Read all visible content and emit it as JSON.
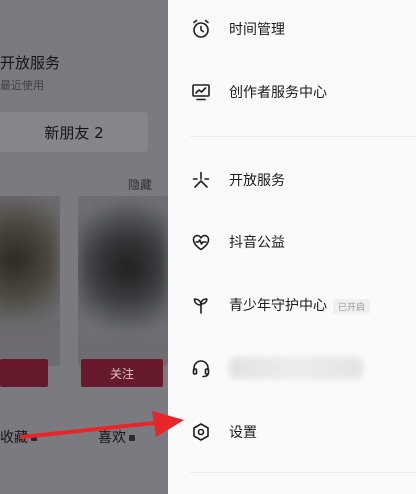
{
  "background": {
    "section_title": "开放服务",
    "section_sub": "最近使用",
    "new_friends": "新朋友 2",
    "hide": "隐藏",
    "follow_button_1": "",
    "follow_button_2": "关注",
    "tab_favorites": "收藏",
    "tab_likes": "喜欢"
  },
  "drawer": {
    "items": [
      {
        "label": "时间管理",
        "icon": "alarm-clock-icon"
      },
      {
        "label": "创作者服务中心",
        "icon": "chart-monitor-icon"
      },
      {
        "label": "开放服务",
        "icon": "asterisk-icon"
      },
      {
        "label": "抖音公益",
        "icon": "heart-pulse-icon"
      },
      {
        "label": "青少年守护中心",
        "icon": "sprout-icon",
        "badge": "已开启"
      },
      {
        "label": "",
        "icon": "headset-icon"
      },
      {
        "label": "设置",
        "icon": "hexagon-gear-icon"
      }
    ]
  },
  "annotation": {
    "arrow_color": "#e8262a"
  },
  "colors": {
    "accent": "#671a2c",
    "drawer_bg": "#fafafa",
    "overlay": "#7b7a80"
  }
}
